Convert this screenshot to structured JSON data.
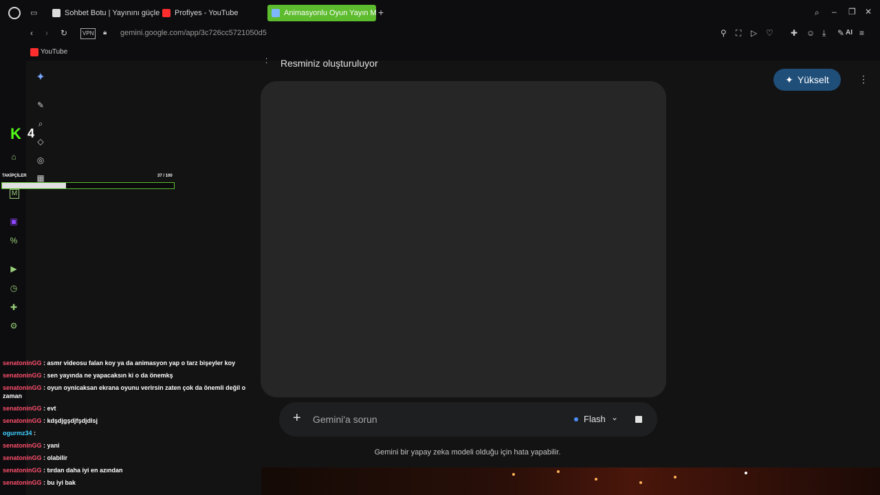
{
  "browser": {
    "tabs": [
      {
        "label": "Sohbet Botu | Yayınını güçle",
        "color": "#dcdcdc"
      },
      {
        "label": "Profiyes - YouTube",
        "color": "#ff2d2d"
      },
      {
        "label": "Animasyonlu Oyun Yayın M",
        "color": "#7fb7ff"
      }
    ],
    "new_tab_symbol": "+",
    "vpn_label": "VPN",
    "url": "gemini.google.com/app/3c726cc5721050d5",
    "ai_label": "AI",
    "bookmark_label": "YouTube"
  },
  "gemini": {
    "status_text": "Resminiz oluşturuluyor",
    "upgrade_label": "Yükselt",
    "prompt_placeholder": "Gemini'a sorun",
    "model_label": "Flash",
    "disclaimer": "Gemini bir yapay zeka modeli olduğu için hata yapabilir.",
    "accent": "#1f4e79"
  },
  "overlay": {
    "kick_letter": "K",
    "kick_count": "4",
    "goal_label": "TAKİPÇİLER",
    "goal_text": "37 / 100",
    "goal_progress": 0.37,
    "chat": [
      {
        "user": "senatoninGG",
        "text": " : asmr videosu falan koy ya da animasyon yap o tarz bişeyler koy"
      },
      {
        "user": "senatoninGG",
        "text": " : sen yayında ne yapacaksın ki o da önemkş"
      },
      {
        "user": "senatoninGG",
        "text": " : oyun oynicaksan ekrana oyunu verirsin zaten çok da önemli değil o zaman"
      },
      {
        "user": "senatoninGG",
        "text": " : evt"
      },
      {
        "user": "senatoninGG",
        "text": " : kdşdjgşdjfşdjdlsj"
      },
      {
        "user": "ogurmz34",
        "text": " : "
      },
      {
        "user": "senatoninGG",
        "text": " : yani"
      },
      {
        "user": "senatoninGG",
        "text": " : olabilir"
      },
      {
        "user": "senatoninGG",
        "text": " : tırdan daha iyi en azından"
      },
      {
        "user": "senatoninGG",
        "text": " : bu iyi bak"
      }
    ]
  }
}
